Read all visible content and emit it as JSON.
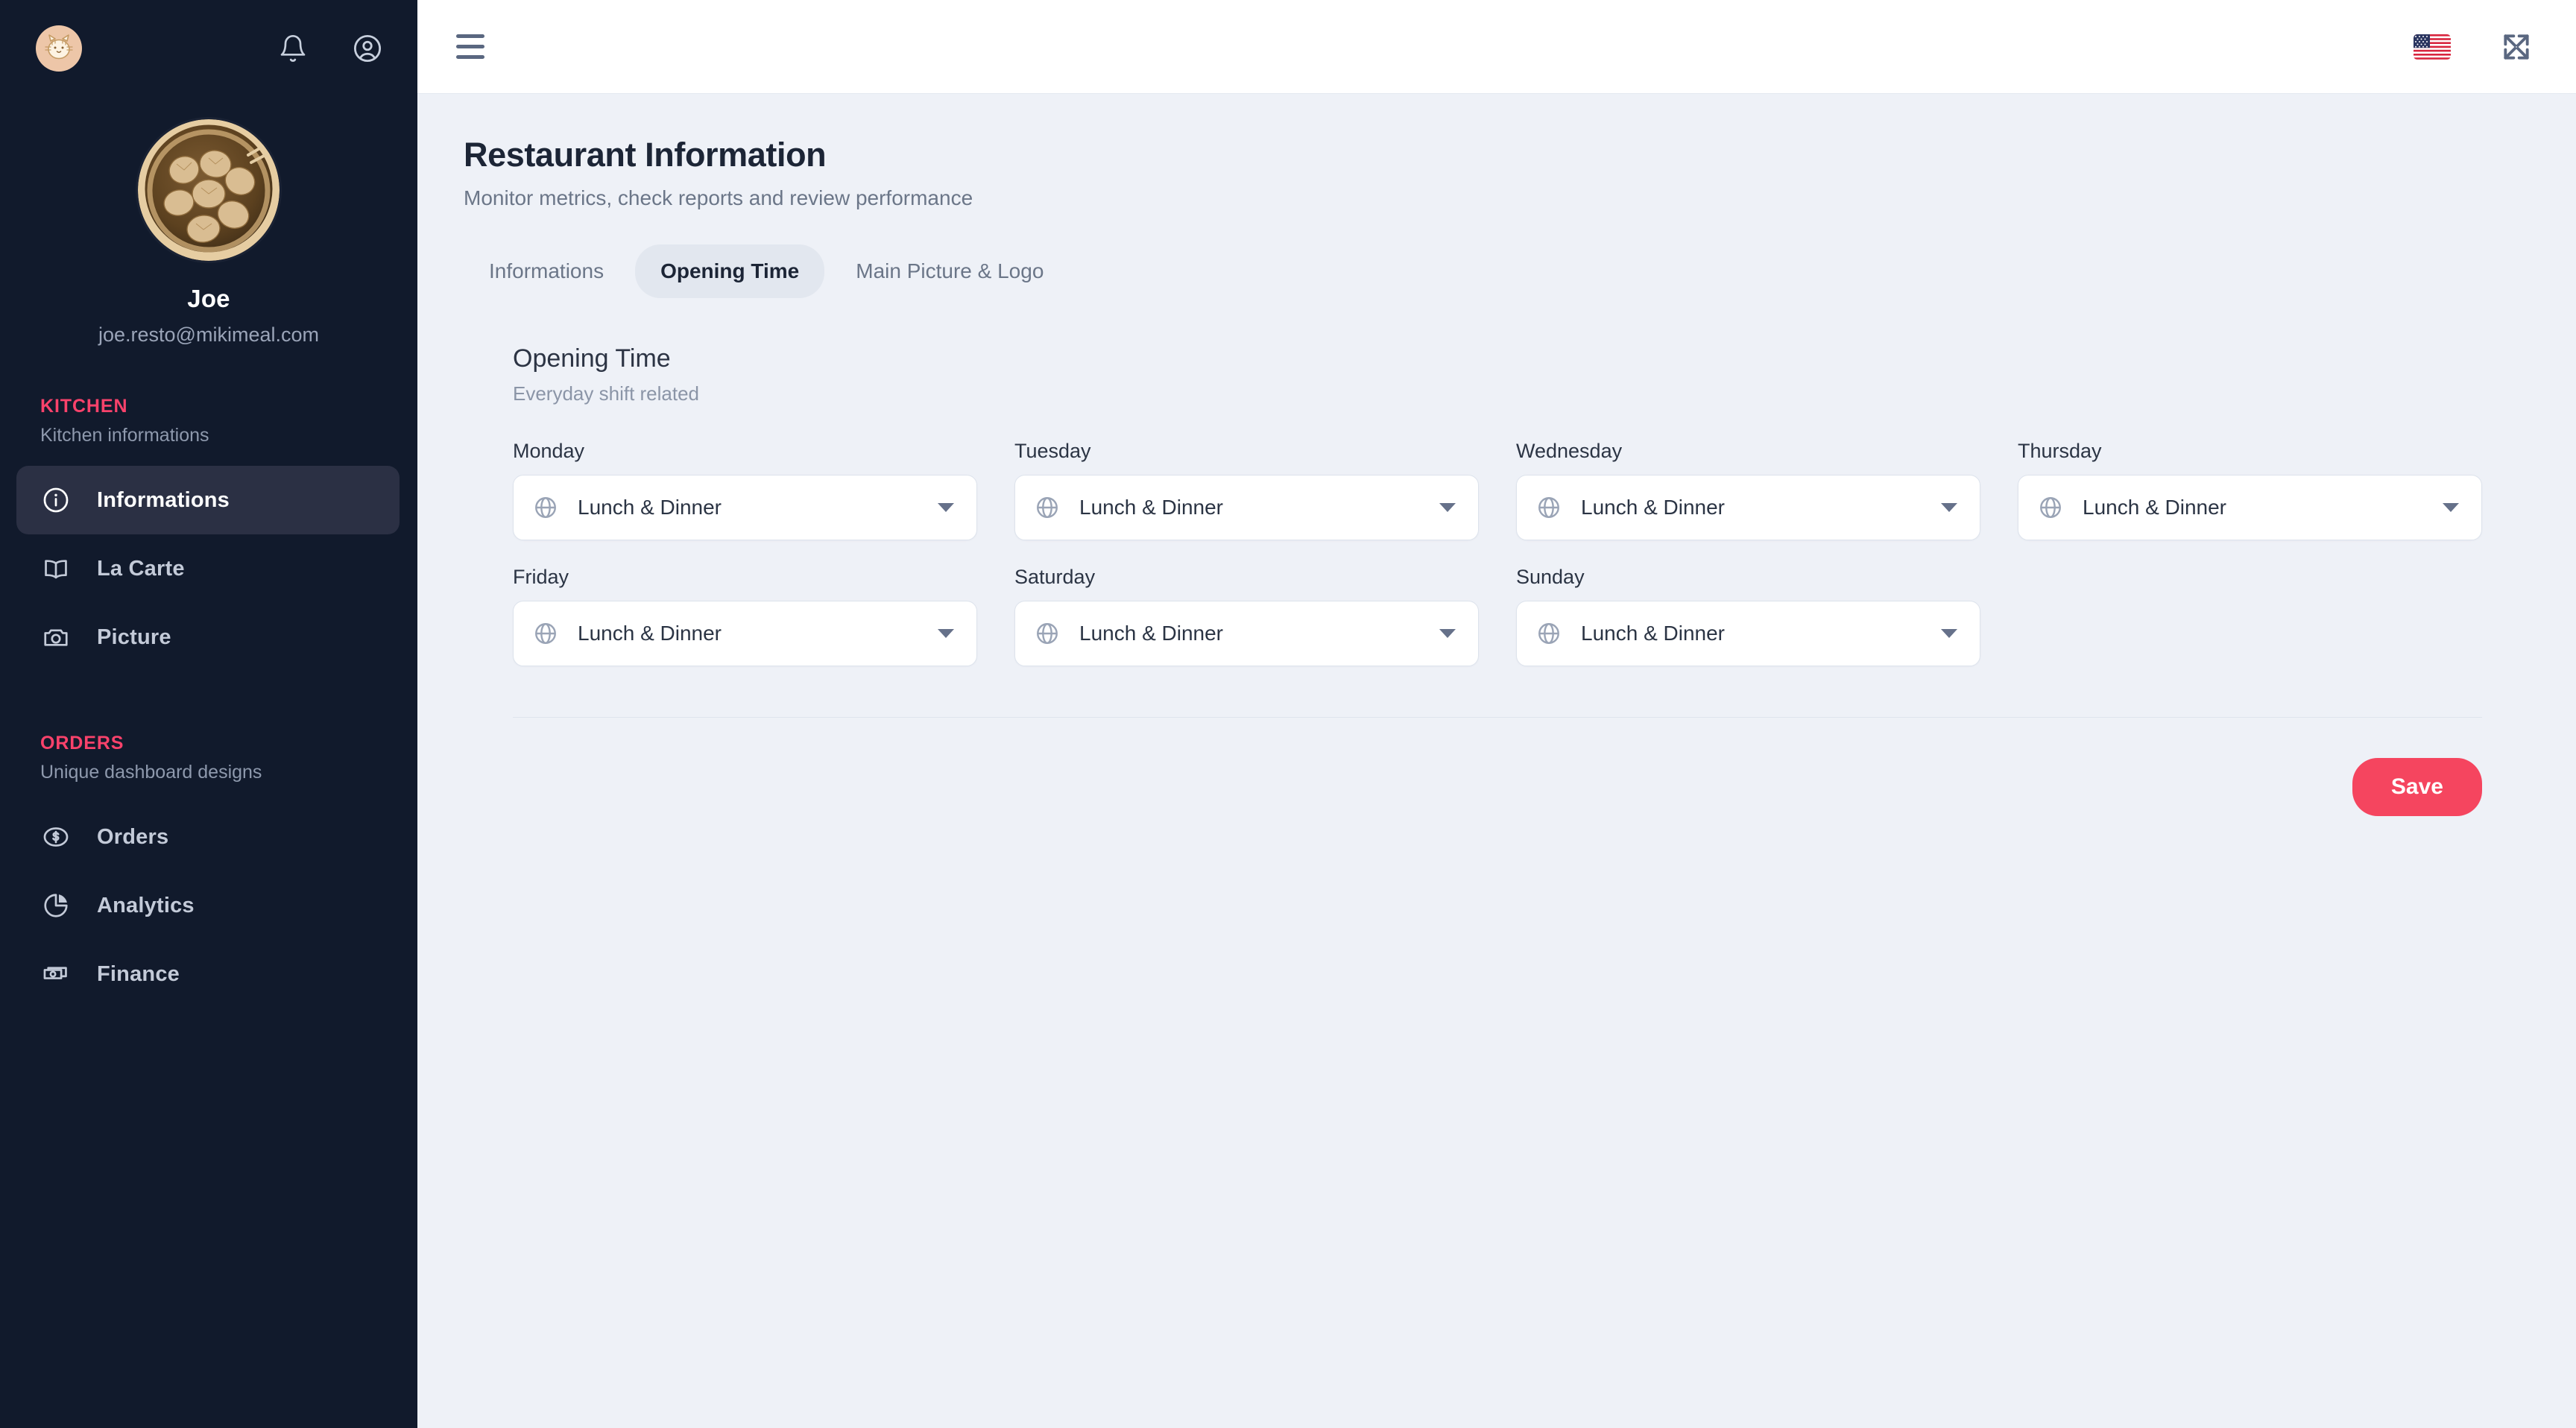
{
  "theme": {
    "sidebar_bg": "#111a2c",
    "sidebar_active_bg": "#2b3044",
    "accent_pink": "#f9426b",
    "save_button_bg": "#f5455f",
    "page_bg": "#eef1f7",
    "topbar_bg": "#ffffff"
  },
  "sidebar": {
    "logo_icon": "cat-face-logo-icon",
    "top_icons": [
      {
        "name": "notifications-bell-icon",
        "glyph": "bell"
      },
      {
        "name": "user-account-icon",
        "glyph": "user-circle"
      }
    ],
    "profile": {
      "avatar_icon": "dumpling-basket-avatar",
      "name": "Joe",
      "email": "joe.resto@mikimeal.com"
    },
    "sections": [
      {
        "title": "KITCHEN",
        "subtitle": "Kitchen informations",
        "items": [
          {
            "label": "Informations",
            "icon": "info-circle-icon",
            "active": true
          },
          {
            "label": "La Carte",
            "icon": "open-book-icon",
            "active": false
          },
          {
            "label": "Picture",
            "icon": "camera-icon",
            "active": false
          }
        ]
      },
      {
        "title": "ORDERS",
        "subtitle": "Unique dashboard designs",
        "items": [
          {
            "label": "Orders",
            "icon": "dollar-coin-icon",
            "active": false
          },
          {
            "label": "Analytics",
            "icon": "pie-chart-icon",
            "active": false
          },
          {
            "label": "Finance",
            "icon": "money-bill-icon",
            "active": false
          }
        ]
      }
    ]
  },
  "topbar": {
    "menu_icon": "hamburger-menu-icon",
    "language_flag": "us-flag-icon",
    "fullscreen_icon": "fullscreen-expand-icon"
  },
  "page": {
    "title": "Restaurant Information",
    "subtitle": "Monitor metrics, check reports and review performance"
  },
  "tabs": [
    {
      "label": "Informations",
      "active": false
    },
    {
      "label": "Opening Time",
      "active": true
    },
    {
      "label": "Main Picture & Logo",
      "active": false
    }
  ],
  "section": {
    "title": "Opening Time",
    "subtitle": "Everyday shift related"
  },
  "days": [
    {
      "label": "Monday",
      "value": "Lunch & Dinner",
      "icon": "globe-icon",
      "caret": "chevron-down-icon"
    },
    {
      "label": "Tuesday",
      "value": "Lunch & Dinner",
      "icon": "globe-icon",
      "caret": "chevron-down-icon"
    },
    {
      "label": "Wednesday",
      "value": "Lunch & Dinner",
      "icon": "globe-icon",
      "caret": "chevron-down-icon"
    },
    {
      "label": "Thursday",
      "value": "Lunch & Dinner",
      "icon": "globe-icon",
      "caret": "chevron-down-icon"
    },
    {
      "label": "Friday",
      "value": "Lunch & Dinner",
      "icon": "globe-icon",
      "caret": "chevron-down-icon"
    },
    {
      "label": "Saturday",
      "value": "Lunch & Dinner",
      "icon": "globe-icon",
      "caret": "chevron-down-icon"
    },
    {
      "label": "Sunday",
      "value": "Lunch & Dinner",
      "icon": "globe-icon",
      "caret": "chevron-down-icon"
    }
  ],
  "footer": {
    "save_label": "Save"
  }
}
